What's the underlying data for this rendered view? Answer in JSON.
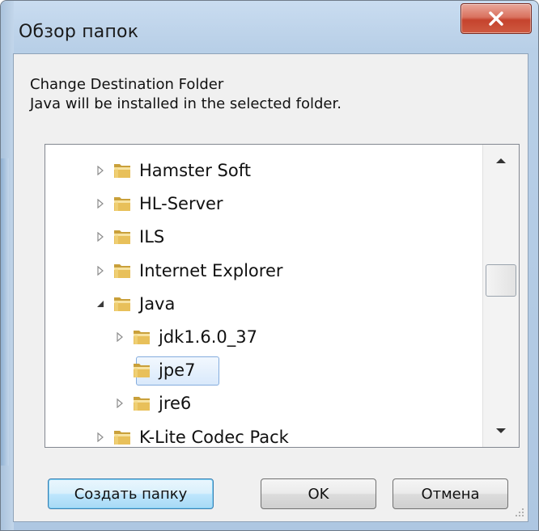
{
  "window": {
    "title": "Обзор папок",
    "close_icon": "close-icon"
  },
  "description": {
    "line1": "Change Destination Folder",
    "line2": "Java will be installed in the selected folder."
  },
  "tree": {
    "items": [
      {
        "label": "Hamster Soft",
        "level": 0,
        "expander": "collapsed"
      },
      {
        "label": "HL-Server",
        "level": 0,
        "expander": "collapsed"
      },
      {
        "label": "ILS",
        "level": 0,
        "expander": "collapsed"
      },
      {
        "label": "Internet Explorer",
        "level": 0,
        "expander": "collapsed"
      },
      {
        "label": "Java",
        "level": 0,
        "expander": "expanded"
      },
      {
        "label": "jdk1.6.0_37",
        "level": 1,
        "expander": "collapsed"
      },
      {
        "label": "jpe7",
        "level": 1,
        "expander": "none",
        "selected": true
      },
      {
        "label": "jre6",
        "level": 1,
        "expander": "collapsed"
      },
      {
        "label": "K-Lite Codec Pack",
        "level": 0,
        "expander": "collapsed"
      }
    ]
  },
  "buttons": {
    "new_folder": "Создать папку",
    "ok": "OK",
    "cancel": "Отмена"
  },
  "colors": {
    "folder": "#e8c05a",
    "selection_border": "#84acdd",
    "close_button": "#c5432d"
  }
}
